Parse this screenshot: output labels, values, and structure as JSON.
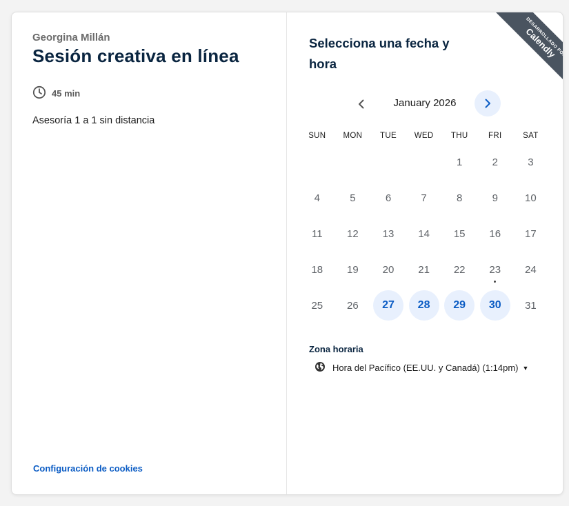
{
  "host": {
    "name": "Georgina Millán"
  },
  "event": {
    "title": "Sesión creativa en línea",
    "duration": "45 min",
    "description": "Asesoría 1 a 1 sin distancia"
  },
  "footer": {
    "cookie_link": "Configuración de cookies"
  },
  "scheduler": {
    "title": "Selecciona una fecha y hora",
    "month_label": "January 2026",
    "weekdays": [
      "SUN",
      "MON",
      "TUE",
      "WED",
      "THU",
      "FRI",
      "SAT"
    ],
    "leading_blanks": 4,
    "days": [
      {
        "n": "1"
      },
      {
        "n": "2"
      },
      {
        "n": "3"
      },
      {
        "n": "4"
      },
      {
        "n": "5"
      },
      {
        "n": "6"
      },
      {
        "n": "7"
      },
      {
        "n": "8"
      },
      {
        "n": "9"
      },
      {
        "n": "10"
      },
      {
        "n": "11"
      },
      {
        "n": "12"
      },
      {
        "n": "13"
      },
      {
        "n": "14"
      },
      {
        "n": "15"
      },
      {
        "n": "16"
      },
      {
        "n": "17"
      },
      {
        "n": "18"
      },
      {
        "n": "19"
      },
      {
        "n": "20"
      },
      {
        "n": "21"
      },
      {
        "n": "22"
      },
      {
        "n": "23",
        "today": true
      },
      {
        "n": "24"
      },
      {
        "n": "25"
      },
      {
        "n": "26"
      },
      {
        "n": "27",
        "available": true
      },
      {
        "n": "28",
        "available": true
      },
      {
        "n": "29",
        "available": true
      },
      {
        "n": "30",
        "available": true
      },
      {
        "n": "31"
      }
    ]
  },
  "timezone": {
    "label": "Zona horaria",
    "value": "Hora del Pacífico (EE.UU. y Canadá) (1:14pm)"
  },
  "ribbon": {
    "small": "DESARROLLADO POR",
    "brand": "Calendly"
  },
  "colors": {
    "accent": "#0b5cc4",
    "available_bg": "#e8f0fd",
    "ribbon_bg": "#4a5460",
    "title": "#0a2540"
  },
  "icons": {
    "duration": "clock-icon",
    "prev": "chevron-left-icon",
    "next": "chevron-right-icon",
    "timezone": "globe-icon",
    "dropdown": "caret-down-icon"
  }
}
